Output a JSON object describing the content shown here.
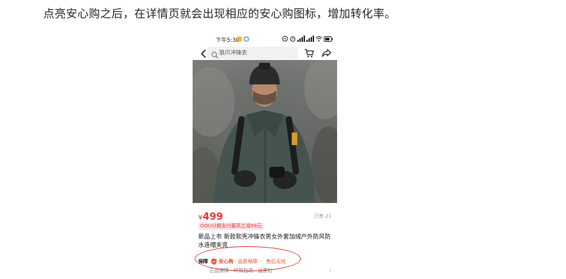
{
  "heading": "点亮安心购之后，在详情页就会出现相应的安心购图标，增加转化率。",
  "status_bar": {
    "time": "下午5:30"
  },
  "top_bar": {
    "search_placeholder": "狼爪冲锋衣"
  },
  "carousel": {
    "page_dots": "●●●●●"
  },
  "product": {
    "currency": "¥",
    "price": "499",
    "sold": "已售 21",
    "promo": "DOU分期支付最高立减99元",
    "title": "新品上市 新款软壳冲锋衣男女外套加绒户外防风防水连帽夹克"
  },
  "guarantee": {
    "label": "保障",
    "brand": "安心购",
    "items": [
      "品质保障",
      "售后无忧"
    ]
  },
  "services": {
    "text": "正品保障 · 坏损包退 · 运费险"
  },
  "colors": {
    "price_red": "#e8333b",
    "brand_orange": "#e5502c",
    "annotation_red": "#d7362b"
  }
}
